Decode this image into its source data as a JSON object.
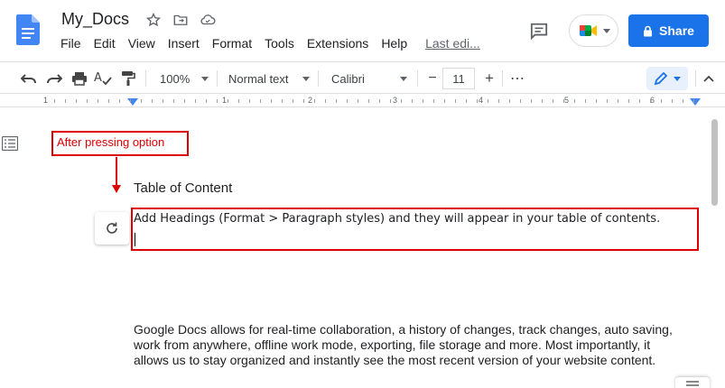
{
  "app": {
    "title": "My_Docs"
  },
  "menu": {
    "items": [
      "File",
      "Edit",
      "View",
      "Insert",
      "Format",
      "Tools",
      "Extensions",
      "Help"
    ],
    "last_edit": "Last edi..."
  },
  "header": {
    "share_label": "Share"
  },
  "toolbar": {
    "zoom": "100%",
    "style": "Normal text",
    "font": "Calibri",
    "font_size": "11",
    "minus": "−",
    "plus": "+",
    "more": "⋯"
  },
  "ruler": {
    "numbers": [
      "1",
      "1",
      "2",
      "3",
      "4",
      "5",
      "6"
    ]
  },
  "annotation": {
    "label": "After pressing option"
  },
  "document": {
    "toc_heading": "Table of Content",
    "toc_placeholder": "Add Headings (Format > Paragraph styles) and they will appear in your table of contents.",
    "body": "Google Docs allows for real-time collaboration, a history of changes, track changes, auto saving, work from anywhere, offline work mode, exporting, file storage and more. Most importantly, it allows us to stay organized and instantly see the most recent version of your website content."
  },
  "colors": {
    "accent": "#1a73e8",
    "annotation": "#dd0000",
    "doc_blue": "#4285f4"
  }
}
